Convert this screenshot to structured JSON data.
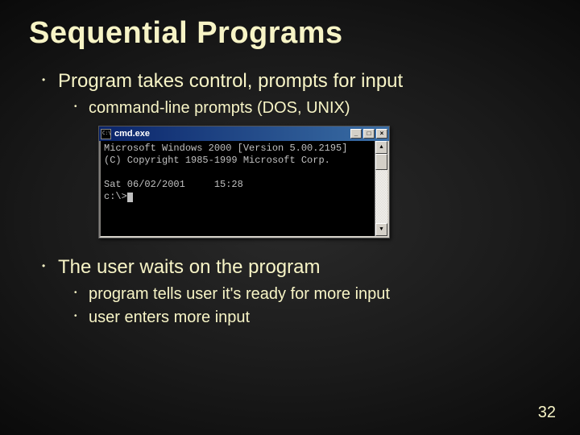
{
  "title": "Sequential Programs",
  "bullets": {
    "b1": "Program takes control, prompts for input",
    "b1a": "command-line prompts (DOS, UNIX)",
    "b2": "The user waits on the program",
    "b2a": "program tells user it's ready for more input",
    "b2b": "user enters more input"
  },
  "cmd": {
    "title": "cmd.exe",
    "line1": "Microsoft Windows 2000 [Version 5.00.2195]",
    "line2": "(C) Copyright 1985-1999 Microsoft Corp.",
    "line3": "Sat 06/02/2001     15:28",
    "prompt": "c:\\>",
    "btn_min": "_",
    "btn_max": "□",
    "btn_close": "×",
    "arrow_up": "▲",
    "arrow_down": "▼"
  },
  "page": "32"
}
